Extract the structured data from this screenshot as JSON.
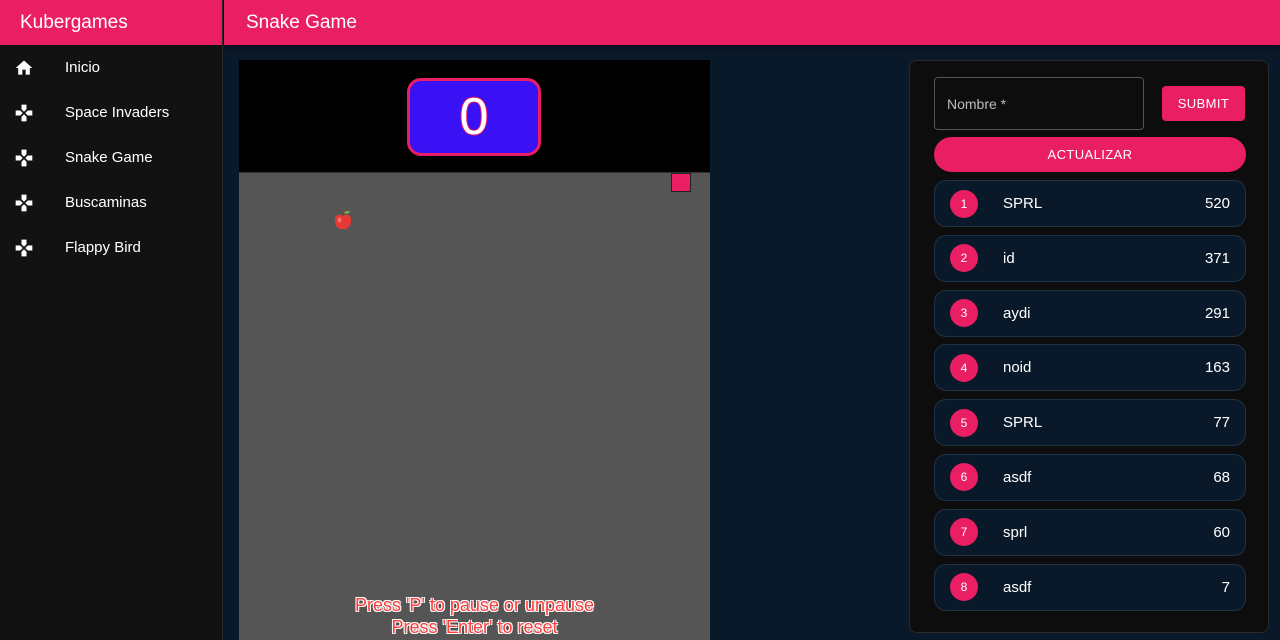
{
  "sidebar": {
    "brand": "Kubergames",
    "items": [
      {
        "label": "Inicio",
        "icon": "home-icon"
      },
      {
        "label": "Space Invaders",
        "icon": "gamepad-icon"
      },
      {
        "label": "Snake Game",
        "icon": "gamepad-icon"
      },
      {
        "label": "Buscaminas",
        "icon": "gamepad-icon"
      },
      {
        "label": "Flappy Bird",
        "icon": "gamepad-icon"
      }
    ]
  },
  "header": {
    "title": "Snake Game"
  },
  "game": {
    "score": "0",
    "instructions": [
      "Press 'P' to pause or unpause",
      "Press 'Enter' to reset"
    ]
  },
  "leaderboard": {
    "name_placeholder": "Nombre *",
    "submit_label": "SUBMIT",
    "refresh_label": "ACTUALIZAR",
    "entries": [
      {
        "rank": "1",
        "name": "SPRL",
        "score": "520"
      },
      {
        "rank": "2",
        "name": "id",
        "score": "371"
      },
      {
        "rank": "3",
        "name": "aydi",
        "score": "291"
      },
      {
        "rank": "4",
        "name": "noid",
        "score": "163"
      },
      {
        "rank": "5",
        "name": "SPRL",
        "score": "77"
      },
      {
        "rank": "6",
        "name": "asdf",
        "score": "68"
      },
      {
        "rank": "7",
        "name": "sprl",
        "score": "60"
      },
      {
        "rank": "8",
        "name": "asdf",
        "score": "7"
      }
    ]
  },
  "colors": {
    "accent": "#e91e63",
    "background": "#0a1929",
    "sidebar": "#121212",
    "score_box": "#3a10f5",
    "board": "#555555"
  }
}
